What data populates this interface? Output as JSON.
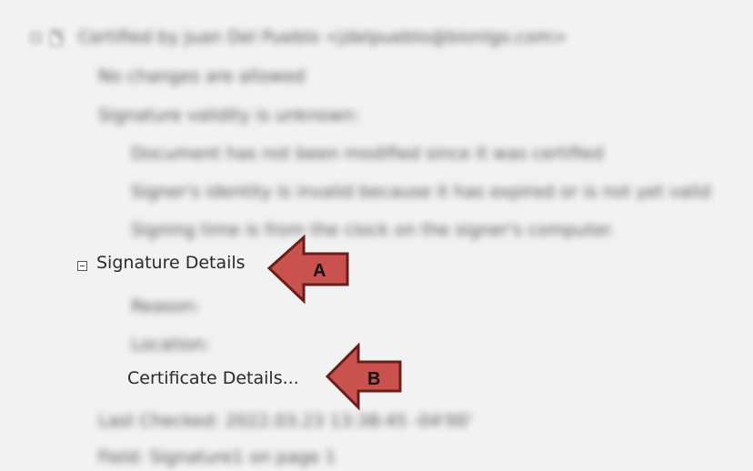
{
  "tree": {
    "root_label": "Certified by Juan Del Pueblo <jdelpueblo@bionlgo.com>",
    "children": [
      "No changes are allowed",
      "Signature validity is unknown:"
    ],
    "validity_details": [
      "Document has not been modified since it was certified",
      "Signer's identity is invalid because it has expired or is not yet valid",
      "Signing time is from the clock on the signer's computer."
    ],
    "signature_details_label": "Signature Details",
    "signature_children": [
      "Reason:",
      "Location:"
    ],
    "certificate_details_label": "Certificate Details...",
    "last_checked": "Last Checked: 2022.03.23 13:38:45 -04'00'",
    "field": "Field: Signature1 on page 1"
  },
  "annotations": {
    "arrow_a_label": "A",
    "arrow_b_label": "B",
    "arrow_fill": "#c9514e",
    "arrow_stroke": "#6a1e1c"
  }
}
